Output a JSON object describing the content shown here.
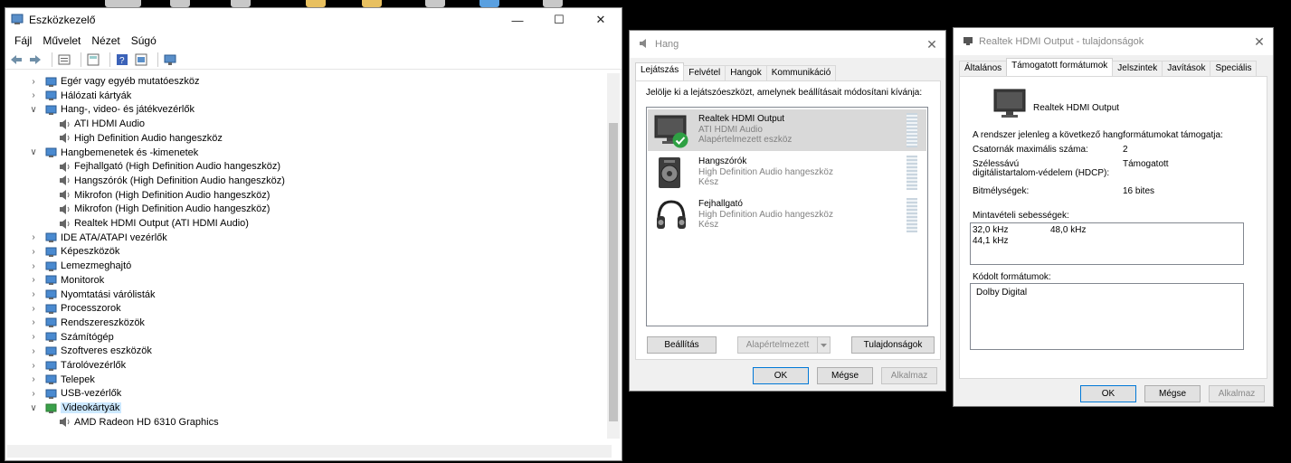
{
  "devmgr": {
    "title": "Eszközkezelő",
    "menu": [
      "Fájl",
      "Művelet",
      "Nézet",
      "Súgó"
    ],
    "tree": [
      {
        "label": "Egér vagy egyéb mutatóeszköz",
        "level": 0,
        "chev": ">"
      },
      {
        "label": "Hálózati kártyák",
        "level": 0,
        "chev": ">"
      },
      {
        "label": "Hang-, video- és játékvezérlők",
        "level": 0,
        "chev": "v"
      },
      {
        "label": "ATI HDMI Audio",
        "level": 1
      },
      {
        "label": "High Definition Audio hangeszköz",
        "level": 1
      },
      {
        "label": "Hangbemenetek és -kimenetek",
        "level": 0,
        "chev": "v"
      },
      {
        "label": "Fejhallgató (High Definition Audio hangeszköz)",
        "level": 1
      },
      {
        "label": "Hangszórók (High Definition Audio hangeszköz)",
        "level": 1
      },
      {
        "label": "Mikrofon (High Definition Audio hangeszköz)",
        "level": 1
      },
      {
        "label": "Mikrofon (High Definition Audio hangeszköz)",
        "level": 1
      },
      {
        "label": "Realtek HDMI Output (ATI HDMI Audio)",
        "level": 1
      },
      {
        "label": "IDE ATA/ATAPI vezérlők",
        "level": 0,
        "chev": ">"
      },
      {
        "label": "Képeszközök",
        "level": 0,
        "chev": ">"
      },
      {
        "label": "Lemezmeghajtó",
        "level": 0,
        "chev": ">"
      },
      {
        "label": "Monitorok",
        "level": 0,
        "chev": ">"
      },
      {
        "label": "Nyomtatási várólisták",
        "level": 0,
        "chev": ">"
      },
      {
        "label": "Processzorok",
        "level": 0,
        "chev": ">"
      },
      {
        "label": "Rendszereszközök",
        "level": 0,
        "chev": ">"
      },
      {
        "label": "Számítógép",
        "level": 0,
        "chev": ">"
      },
      {
        "label": "Szoftveres eszközök",
        "level": 0,
        "chev": ">"
      },
      {
        "label": "Tárolóvezérlők",
        "level": 0,
        "chev": ">"
      },
      {
        "label": "Telepek",
        "level": 0,
        "chev": ">"
      },
      {
        "label": "USB-vezérlők",
        "level": 0,
        "chev": ">"
      },
      {
        "label": "Videokártyák",
        "level": 0,
        "chev": "v",
        "selected": true
      },
      {
        "label": "AMD Radeon HD 6310 Graphics",
        "level": 1
      }
    ]
  },
  "hang": {
    "title": "Hang",
    "tabs": [
      "Lejátszás",
      "Felvétel",
      "Hangok",
      "Kommunikáció"
    ],
    "instruction": "Jelölje ki a lejátszóeszközt, amelynek beállításait módosítani kívánja:",
    "devices": [
      {
        "name": "Realtek HDMI Output",
        "sub": "ATI HDMI Audio",
        "status": "Alapértelmezett eszköz"
      },
      {
        "name": "Hangszórók",
        "sub": "High Definition Audio hangeszköz",
        "status": "Kész"
      },
      {
        "name": "Fejhallgató",
        "sub": "High Definition Audio hangeszköz",
        "status": "Kész"
      }
    ],
    "btn_config": "Beállítás",
    "btn_default": "Alapértelmezett",
    "btn_props": "Tulajdonságok",
    "btn_ok": "OK",
    "btn_cancel": "Mégse",
    "btn_apply": "Alkalmaz"
  },
  "props": {
    "title": "Realtek HDMI Output - tulajdonságok",
    "tabs": [
      "Általános",
      "Támogatott formátumok",
      "Jelszintek",
      "Javítások",
      "Speciális"
    ],
    "device_name": "Realtek HDMI Output",
    "intro": "A rendszer jelenleg a következő hangformátumokat támogatja:",
    "max_channels_label": "Csatornák maximális száma:",
    "max_channels_value": "2",
    "hdcp_label_1": "Szélessávú",
    "hdcp_label_2": "digitálistartalom-védelem (HDCP):",
    "hdcp_value": "Támogatott",
    "bit_label": "Bitmélységek:",
    "bit_value": "16 bites",
    "rates_label": "Mintavételi sebességek:",
    "rates": [
      "32,0 kHz",
      "48,0 kHz",
      "44,1 kHz"
    ],
    "encoded_label": "Kódolt formátumok:",
    "encoded": [
      "Dolby Digital"
    ],
    "btn_ok": "OK",
    "btn_cancel": "Mégse",
    "btn_apply": "Alkalmaz"
  }
}
